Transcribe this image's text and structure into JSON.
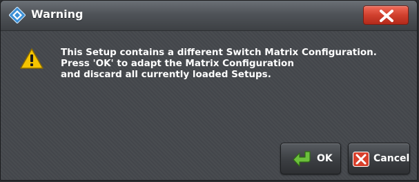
{
  "dialog": {
    "title": "Warning",
    "app_icon": "rohde-schwarz-diamond-icon",
    "close_icon": "close-x-icon",
    "warning_icon": "warning-triangle-icon",
    "message": "This Setup contains a different Switch Matrix Configuration.\nPress 'OK' to adapt the Matrix Configuration\nand discard all currently loaded Setups.",
    "buttons": {
      "ok_label": "OK",
      "ok_icon": "green-arrow-icon",
      "cancel_label": "Cancel",
      "cancel_icon": "red-x-icon"
    }
  },
  "colors": {
    "background": "#464a4f",
    "titlebar": "#55595e",
    "close_button": "#d0402e",
    "text": "#ffffff",
    "warning_yellow": "#f5c400",
    "ok_green": "#5aa632"
  }
}
